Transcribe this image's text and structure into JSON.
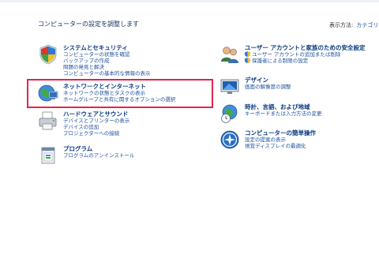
{
  "header": {
    "title": "コンピューターの設定を調整します",
    "view_by_label": "表示方法:",
    "view_by_value": "カテゴリ"
  },
  "categories_left": [
    {
      "id": "system-security",
      "title": "システムとセキュリティ",
      "links": [
        "コンピューターの状態を確認",
        "バックアップの作成",
        "問題の発見と解決",
        "コンピューターの基本的な情報の表示"
      ]
    },
    {
      "id": "network-internet",
      "title": "ネットワークとインターネット",
      "links": [
        "ネットワークの状態とタスクの表示",
        "ホームグループと共有に関するオプションの選択"
      ]
    },
    {
      "id": "hardware-sound",
      "title": "ハードウェアとサウンド",
      "links": [
        "デバイスとプリンターの表示",
        "デバイスの追加",
        "プロジェクターへの接続"
      ]
    },
    {
      "id": "programs",
      "title": "プログラム",
      "links": [
        "プログラムのアンインストール"
      ]
    }
  ],
  "categories_right": [
    {
      "id": "user-accounts",
      "title": "ユーザー アカウントと家族のための安全設定",
      "links": [
        "ユーザー アカウントの追加または削除",
        "保護者による制限の設定"
      ]
    },
    {
      "id": "appearance",
      "title": "デザイン",
      "links": [
        "画面の解像度の調整"
      ]
    },
    {
      "id": "clock-language",
      "title": "時計、言語、および地域",
      "links": [
        "キーボードまたは入力方法の変更"
      ]
    },
    {
      "id": "ease-of-access",
      "title": "コンピューターの簡単操作",
      "links": [
        "設定の提案の表示",
        "視覚ディスプレイの最適化"
      ]
    }
  ],
  "colors": {
    "title_blue": "#0b3a80",
    "link_blue": "#1d4f9e",
    "highlight_red": "#e3244f"
  }
}
